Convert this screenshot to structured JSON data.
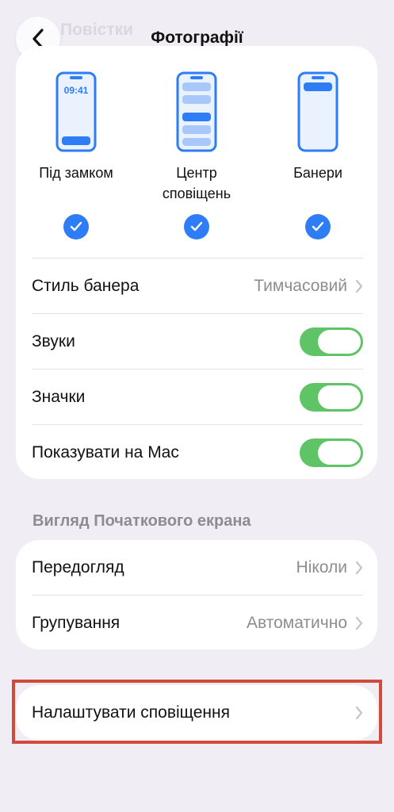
{
  "nav": {
    "back_title": "Повістки",
    "title": "Фотографії"
  },
  "alert_styles": [
    {
      "label": "Під замком",
      "time": "09:41",
      "checked": true
    },
    {
      "label": "Центр сповіщень",
      "checked": true
    },
    {
      "label": "Банери",
      "checked": true
    }
  ],
  "rows": {
    "banner_style": {
      "label": "Стиль банера",
      "value": "Тимчасовий"
    },
    "sounds": {
      "label": "Звуки",
      "on": true
    },
    "badges": {
      "label": "Значки",
      "on": true
    },
    "show_on_mac": {
      "label": "Показувати на Mac",
      "on": true
    }
  },
  "home_section": {
    "header": "Вигляд Початкового екрана",
    "preview": {
      "label": "Передогляд",
      "value": "Ніколи"
    },
    "grouping": {
      "label": "Групування",
      "value": "Автоматично"
    }
  },
  "configure": {
    "label": "Налаштувати сповіщення"
  },
  "colors": {
    "accent": "#2f7df6",
    "toggle_on": "#5fc466",
    "highlight": "#d24a3c",
    "background": "#f0edf4"
  }
}
